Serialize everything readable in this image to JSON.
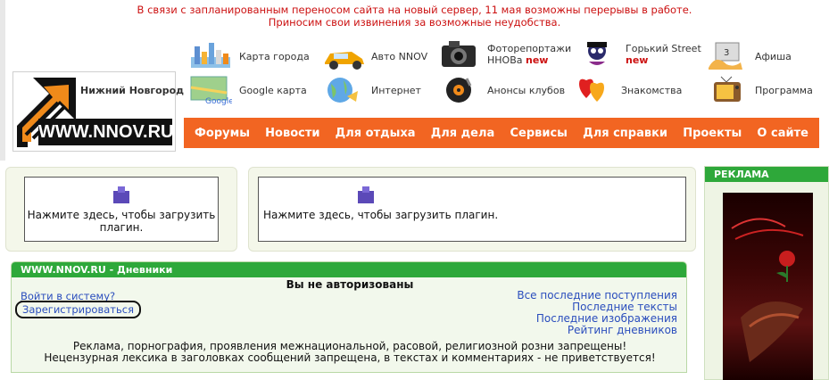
{
  "notice": {
    "line1": "В связи с запланированным переносом сайта на новый сервер, 11 мая возможны перерывы в работе.",
    "line2": "Приносим свои извинения за возможные неудобства."
  },
  "logo": {
    "city": "Нижний Новгород",
    "site": "WWW.NNOV.RU"
  },
  "quick_links": [
    {
      "label": "Карта города",
      "icon": "city-map-icon"
    },
    {
      "label": "Авто NNOV",
      "icon": "car-icon"
    },
    {
      "label": "Фоторепортажи",
      "label2": "ННОВа",
      "new": "new",
      "icon": "camera-icon"
    },
    {
      "label": "Горький Street",
      "new": "new",
      "icon": "gorky-street-icon"
    },
    {
      "label": "Афиша",
      "icon": "afisha-icon"
    },
    {
      "label": "Google карта",
      "icon": "google-map-icon"
    },
    {
      "label": "Интернет",
      "icon": "internet-icon"
    },
    {
      "label": "Анонсы клубов",
      "icon": "club-disc-icon"
    },
    {
      "label": "Знакомства",
      "icon": "hearts-icon"
    },
    {
      "label": "Программа",
      "icon": "tv-icon"
    }
  ],
  "nav": [
    "Форумы",
    "Новости",
    "Для отдыха",
    "Для дела",
    "Сервисы",
    "Для справки",
    "Проекты",
    "О сайте"
  ],
  "plugins": {
    "left": "Нажмите здесь, чтобы загрузить плагин.",
    "right": "Нажмите здесь, чтобы загрузить плагин."
  },
  "diary": {
    "title": "WWW.NNOV.RU - Дневники",
    "not_authorized": "Вы не авторизованы",
    "login": "Войти в систему?",
    "register": "Зарегистрироваться",
    "links": [
      "Все последние поступления",
      "Последние тексты",
      "Последние изображения",
      "Рейтинг дневников"
    ],
    "rule1": "Реклама, порнография, проявления межнациональной, расовой, религиозной розни запрещены!",
    "rule2": "Нецензурная лексика в заголовках сообщений запрещена, в текстах и комментариях - не приветствуется!"
  },
  "ads": {
    "title": "РЕКЛАМА"
  },
  "colors": {
    "nav_bg": "#f26522",
    "green_header": "#2ea83a",
    "notice": "#cc1111",
    "link": "#2a4dbd"
  }
}
